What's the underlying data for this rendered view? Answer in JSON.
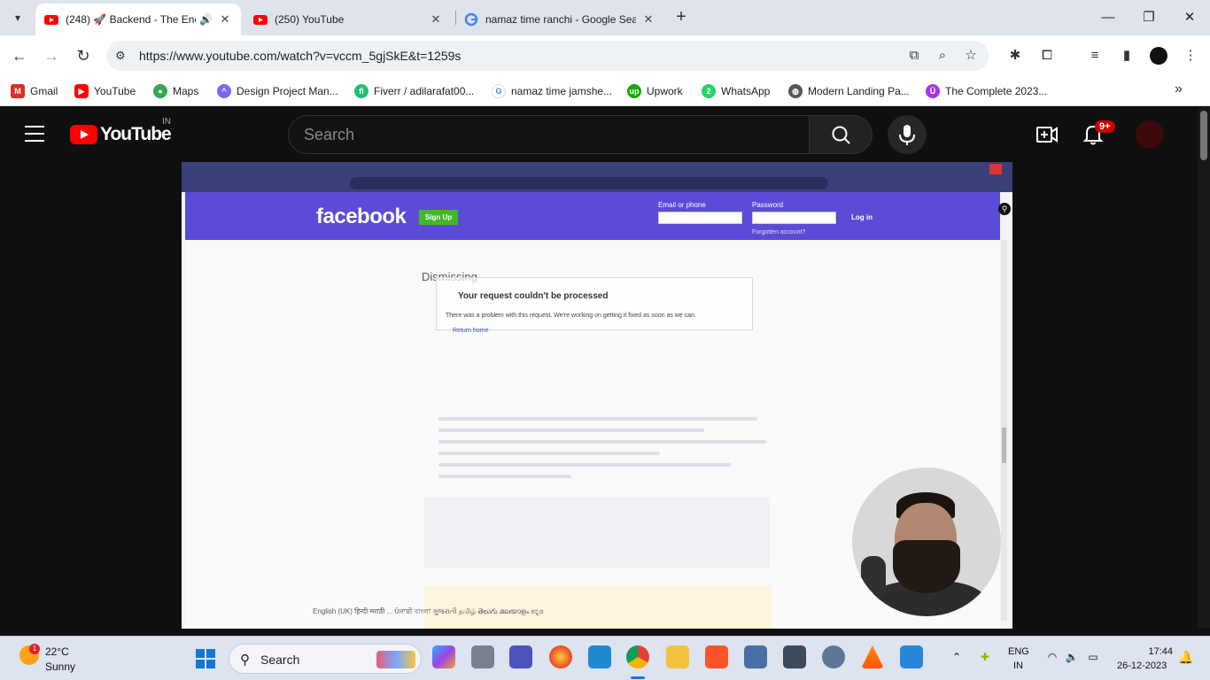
{
  "browser": {
    "tabs": [
      {
        "title": "(248) 🚀 Backend - The Enc",
        "active": true,
        "audio": true
      },
      {
        "title": "(250) YouTube",
        "active": false
      },
      {
        "title": "namaz time ranchi - Google Sea",
        "active": false
      }
    ],
    "url": "https://www.youtube.com/watch?v=vccm_5gjSkE&t=1259s",
    "bookmarks": [
      {
        "label": "Gmail",
        "icon": "gmail-icon",
        "color": "#d93025"
      },
      {
        "label": "YouTube",
        "icon": "youtube-icon",
        "color": "#ff0000"
      },
      {
        "label": "Maps",
        "icon": "maps-icon",
        "color": "#34a853"
      },
      {
        "label": "Design Project Man...",
        "icon": "clickup-icon",
        "color": "#7b68ee"
      },
      {
        "label": "Fiverr / adilarafat00...",
        "icon": "fiverr-icon",
        "color": "#1dbf73"
      },
      {
        "label": "namaz time jamshe...",
        "icon": "google-icon",
        "color": "#4285f4"
      },
      {
        "label": "Upwork",
        "icon": "upwork-icon",
        "color": "#14a800"
      },
      {
        "label": "WhatsApp",
        "icon": "whatsapp-icon",
        "color": "#25d366"
      },
      {
        "label": "Modern Landing Pa...",
        "icon": "globe-icon",
        "color": "#555555"
      },
      {
        "label": "The Complete 2023...",
        "icon": "udemy-icon",
        "color": "#a435f0"
      }
    ]
  },
  "youtube": {
    "logo_text": "YouTube",
    "country_code": "IN",
    "search_placeholder": "Search",
    "notification_count": "9+"
  },
  "video_content": {
    "fb_logo": "facebook",
    "fb_signup": "Sign Up",
    "fb_email_label": "Email or phone",
    "fb_password_label": "Password",
    "fb_login": "Log in",
    "fb_forgot": "Forgotten account?",
    "doc_heading": "Dismissing",
    "error_title": "Your request couldn't be processed",
    "error_message": "There was a problem with this request. We're working on getting it fixed as soon as we can.",
    "error_link": "Return home",
    "languages": "English (UK)  हिन्दी  मराठी  ...  ਪੰਜਾਬੀ  বাংলা  ગુજરાતી  தமிழ்  తెలుగు  മലയാളം  ಕನ್ನಡ"
  },
  "taskbar": {
    "weather_temp": "22°C",
    "weather_desc": "Sunny",
    "weather_badge": "1",
    "search_label": "Search",
    "lang_line1": "ENG",
    "lang_line2": "IN",
    "time": "17:44",
    "date": "26-12-2023"
  }
}
